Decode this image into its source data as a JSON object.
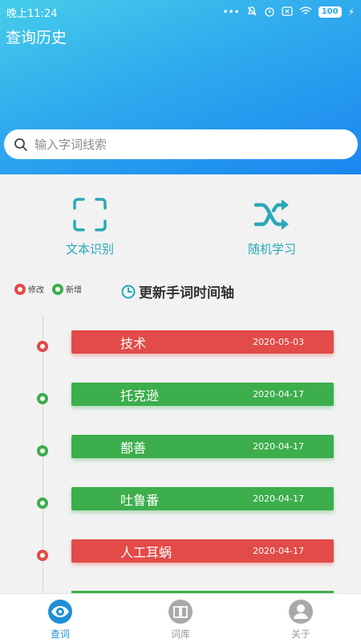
{
  "status": {
    "time": "晚上11:24",
    "battery": "100"
  },
  "app": {
    "title": "查询历史"
  },
  "search": {
    "placeholder": "输入字词线索"
  },
  "actions": [
    {
      "label": "文本识别",
      "icon": "scan-frame-icon"
    },
    {
      "label": "随机学习",
      "icon": "shuffle-icon"
    }
  ],
  "legend": {
    "modified": "修改",
    "added": "新增"
  },
  "timeline": {
    "title": "更新手词时间轴",
    "entries": [
      {
        "word": "技术",
        "date": "2020-05-03",
        "type": "modified"
      },
      {
        "word": "托克逊",
        "date": "2020-04-17",
        "type": "added"
      },
      {
        "word": "鄯善",
        "date": "2020-04-17",
        "type": "added"
      },
      {
        "word": "吐鲁番",
        "date": "2020-04-17",
        "type": "added"
      },
      {
        "word": "人工耳蜗",
        "date": "2020-04-17",
        "type": "modified"
      }
    ]
  },
  "tabs": [
    {
      "label": "查词",
      "icon": "eye-icon",
      "active": true
    },
    {
      "label": "词库",
      "icon": "book-icon",
      "active": false
    },
    {
      "label": "关于",
      "icon": "person-icon",
      "active": false
    }
  ],
  "colors": {
    "modified": "#e24b48",
    "added": "#3cae4c",
    "accent": "#2aa8b8",
    "header": "#2fa9ee"
  }
}
